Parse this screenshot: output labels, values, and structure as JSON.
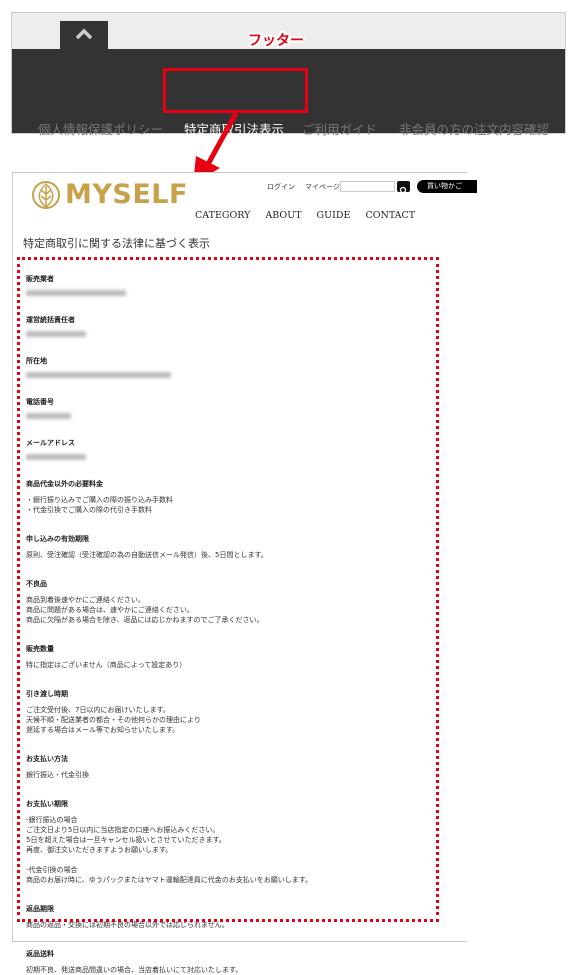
{
  "annotation": {
    "footer_label": "フッター",
    "highlight_color": "#e60012"
  },
  "footer": {
    "links": [
      "個人情報保護ポリシー",
      "特定商取引法表示",
      "ご利用ガイド",
      "非会員の方の注文内容確認"
    ],
    "active_index": 1,
    "pagetop_icon": "chevron-up-icon"
  },
  "site": {
    "logo": "MYSELF",
    "brand_color": "#c8a24a",
    "header_links": [
      "ログイン",
      "マイページ"
    ],
    "search_placeholder": "",
    "search_icon": "search-icon",
    "cart_label": "買い物かご",
    "nav": [
      "CATEGORY",
      "ABOUT",
      "GUIDE",
      "CONTACT"
    ]
  },
  "page": {
    "title": "特定商取引に関する法律に基づく表示",
    "sections": [
      {
        "heading": "販売業者",
        "lines": [],
        "blurred": true
      },
      {
        "heading": "運営統括責任者",
        "lines": [],
        "blurred": true
      },
      {
        "heading": "所在地",
        "lines": [],
        "blurred": true
      },
      {
        "heading": "電話番号",
        "lines": [],
        "blurred": true
      },
      {
        "heading": "メールアドレス",
        "lines": [],
        "blurred": true
      },
      {
        "heading": "商品代金以外の必要料金",
        "lines": [
          "・銀行振り込みでご購入の際の振り込み手数料",
          "・代金引換でご購入の際の代引き手数料"
        ]
      },
      {
        "heading": "申し込みの有効期限",
        "lines": [
          "原則、受注確認（受注確認の為の自動送信メール発信）後、5日間とします。"
        ]
      },
      {
        "heading": "不良品",
        "lines": [
          "商品到着後速やかにご連絡ください。",
          "商品に問題がある場合は、速やかにご連絡ください。",
          "商品に欠陥がある場合を除き、返品には応じかねますのでご了承ください。"
        ]
      },
      {
        "heading": "販売数量",
        "lines": [
          "特に指定はございません（商品によって設定あり）"
        ]
      },
      {
        "heading": "引き渡し時期",
        "lines": [
          "ご注文受付後、7日以内にお届けいたします。",
          "天候不順・配送業者の都合・その他何らかの理由により",
          "遅延する場合はメール等でお知らせいたします。"
        ]
      },
      {
        "heading": "お支払い方法",
        "lines": [
          "銀行振込・代金引換"
        ]
      },
      {
        "heading": "お支払い期限",
        "lines": [
          "-銀行振込の場合",
          "ご注文日より5日以内に当店指定の口座へお振込みください。",
          "5日を超えた場合は一旦キャンセル扱いとさせていただきます。",
          "再度、御注文いただきますようお願いします。",
          "",
          "-代金引換の場合",
          "商品のお届け時に、ゆうパックまたはヤマト運輸配達員に代金のお支払いをお願いします。"
        ]
      },
      {
        "heading": "返品期限",
        "lines": [
          "商品の返品・交換には初期不良の場合以外では応じられません。"
        ]
      },
      {
        "heading": "返品送料",
        "lines": [
          "初期不良、発送商品間違いの場合、当店着払いにて対応いたします。"
        ]
      }
    ]
  }
}
